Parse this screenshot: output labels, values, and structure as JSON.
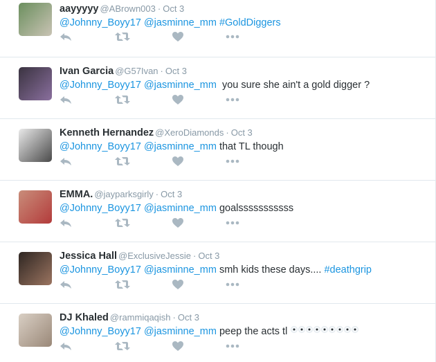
{
  "tweets": [
    {
      "name": "aayyyyy",
      "handle": "@ABrown003",
      "time": "Oct 3",
      "mention1": "@Johnny_Boyy17",
      "mention2": "@jasminne_mm",
      "rest": "",
      "hashtag": "#GoldDiggers",
      "avatar_colors": [
        "#6b8f5e",
        "#c9c3b4"
      ]
    },
    {
      "name": "Ivan Garcia",
      "handle": "@G57Ivan",
      "time": "Oct 3",
      "mention1": "@Johnny_Boyy17",
      "mention2": "@jasminne_mm",
      "rest": "  you sure she ain't a gold digger ?",
      "hashtag": "",
      "avatar_colors": [
        "#3a3340",
        "#8a6f9e"
      ]
    },
    {
      "name": "Kenneth Hernandez",
      "handle": "@XeroDiamonds",
      "time": "Oct 3",
      "mention1": "@Johnny_Boyy17",
      "mention2": "@jasminne_mm",
      "rest": " that TL though",
      "hashtag": "",
      "avatar_colors": [
        "#e9e9e9",
        "#4a4a4a"
      ]
    },
    {
      "name": "EMMA.",
      "handle": "@jayparksgirly",
      "time": "Oct 3",
      "mention1": "@Johnny_Boyy17",
      "mention2": "@jasminne_mm",
      "rest": " goalsssssssssss",
      "hashtag": "",
      "avatar_colors": [
        "#c98d7a",
        "#b33b3b"
      ]
    },
    {
      "name": "Jessica Hall",
      "handle": "@ExclusiveJessie",
      "time": "Oct 3",
      "mention1": "@Johnny_Boyy17",
      "mention2": "@jasminne_mm",
      "rest": " smh kids these days.... ",
      "hashtag": "#deathgrip",
      "avatar_colors": [
        "#2e2622",
        "#9b7460"
      ]
    },
    {
      "name": "DJ Khaled",
      "handle": "@rammiqaqish",
      "time": "Oct 3",
      "mention1": "@Johnny_Boyy17",
      "mention2": "@jasminne_mm",
      "rest": " peep the acts tl",
      "hashtag": "",
      "avatar_colors": [
        "#d9cfc4",
        "#9a8878"
      ]
    }
  ],
  "colors": {
    "link": "#1b95e0",
    "muted": "#8899a6",
    "icon": "#aab8c2",
    "border": "#e1e8ed"
  },
  "icons": [
    "reply-icon",
    "retweet-icon",
    "heart-icon",
    "more-dots-icon"
  ]
}
